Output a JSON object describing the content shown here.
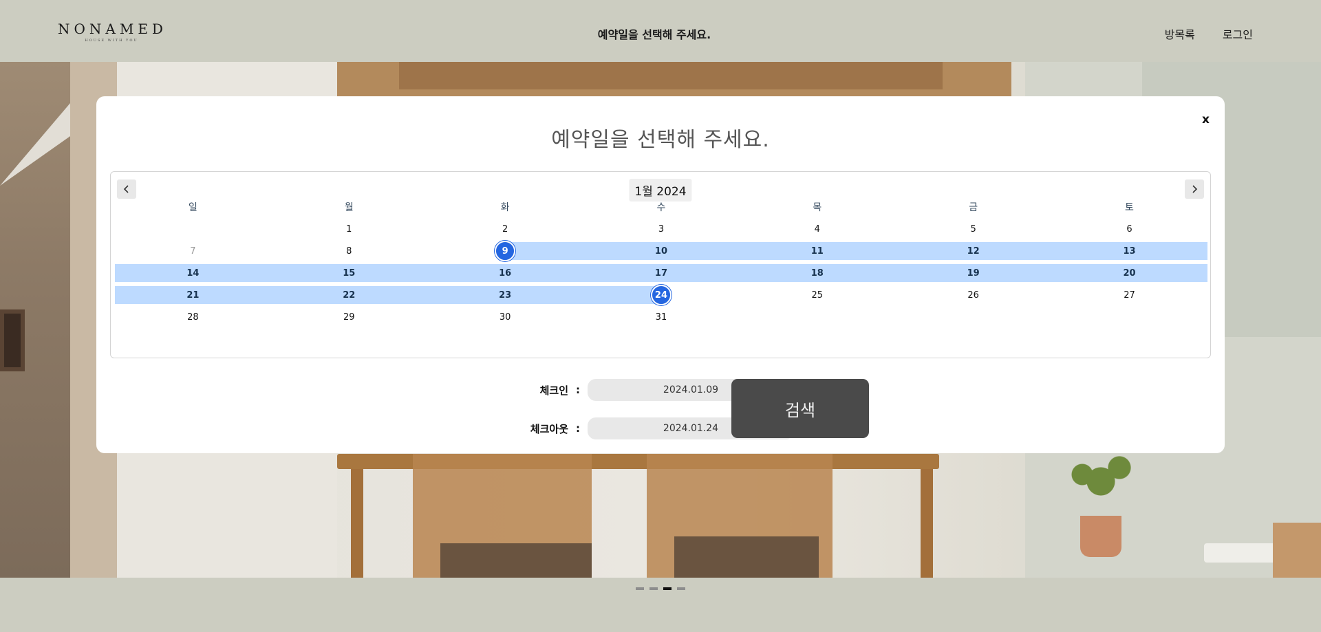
{
  "header": {
    "logo_main": "NONAMED",
    "logo_sub": "HOUSE WITH YOU",
    "title": "예약일을  선택해  주세요.",
    "nav": [
      "방목록",
      "로그인"
    ]
  },
  "modal": {
    "title": "예약일을  선택해  주세요.",
    "close_label": "x",
    "calendar": {
      "month_label": "1월 2024",
      "prev_icon": "chevron-left-icon",
      "next_icon": "chevron-right-icon",
      "weekdays": [
        "일",
        "월",
        "화",
        "수",
        "목",
        "금",
        "토"
      ],
      "weeks": [
        [
          "",
          "1",
          "2",
          "3",
          "4",
          "5",
          "6"
        ],
        [
          "7",
          "8",
          "9",
          "10",
          "11",
          "12",
          "13"
        ],
        [
          "14",
          "15",
          "16",
          "17",
          "18",
          "19",
          "20"
        ],
        [
          "21",
          "22",
          "23",
          "24",
          "25",
          "26",
          "27"
        ],
        [
          "28",
          "29",
          "30",
          "31",
          "",
          "",
          ""
        ]
      ],
      "range_start": 9,
      "range_end": 24,
      "muted_days": [
        7
      ]
    },
    "checkin": {
      "label": "체크인",
      "colon": ":",
      "value": "2024.01.09"
    },
    "checkout": {
      "label": "체크아웃",
      "colon": ":",
      "value": "2024.01.24"
    },
    "search_label": "검색"
  },
  "slider": {
    "count": 4,
    "active_index": 2
  },
  "colors": {
    "accent": "#2466e0",
    "range": "#bddaff",
    "header_bg": "#cccdc1",
    "search_bg": "#4a4a4a"
  }
}
